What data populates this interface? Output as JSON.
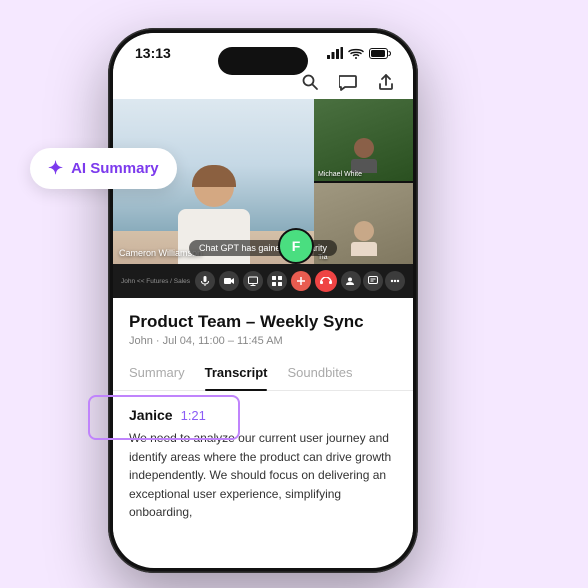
{
  "badge": {
    "label": "AI Summary",
    "icon": "✦"
  },
  "status_bar": {
    "time": "13:13",
    "signal_icon": "📶",
    "wifi_icon": "WiFi",
    "battery_icon": "🔋"
  },
  "action_bar": {
    "search_icon": "search",
    "chat_icon": "chat",
    "share_icon": "share"
  },
  "video": {
    "main_person_name": "Cameron Williamson",
    "subtitle": "Chat GPT has gained popularity",
    "sidebar_1_name": "Michael White",
    "sidebar_2_name": "Tia",
    "avatar_label": "F"
  },
  "controls": {
    "left_label": "John << Futures / Sales",
    "end_call_label": "end"
  },
  "meeting": {
    "title": "Product Team – Weekly Sync",
    "meta": "John · Jul 04, 11:00 – 11:45 AM"
  },
  "tabs": [
    {
      "label": "Summary",
      "active": false
    },
    {
      "label": "Transcript",
      "active": true
    },
    {
      "label": "Soundbites",
      "active": false
    }
  ],
  "transcript": {
    "speaker": "Janice",
    "time": "1:21",
    "text": "We need to analyze our current user journey and identify areas where the product can drive growth independently. We should focus on delivering an exceptional user experience, simplifying onboarding,"
  }
}
